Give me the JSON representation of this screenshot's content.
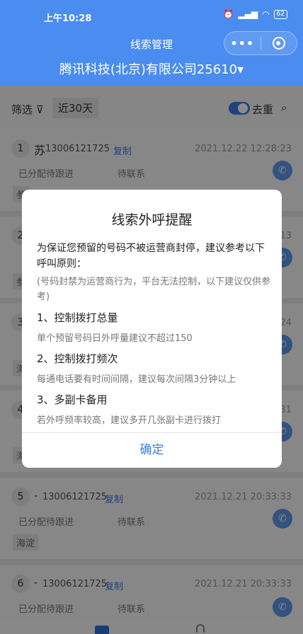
{
  "status": {
    "time": "上午10:28",
    "battery": "62"
  },
  "nav": {
    "title": "线索管理",
    "more": "•••"
  },
  "company": "腾讯科技(北京)有限公司25610▾",
  "filter": {
    "label": "筛选 ⊽",
    "range": "近30天",
    "dedup": "去重"
  },
  "cards": [
    {
      "num": "1",
      "name": "苏",
      "phone": "13006121725",
      "copy": "复制",
      "time": "2021.12.22 12:28:23",
      "status1": "已分配待跟进",
      "status2": "待联系",
      "tag": "参"
    },
    {
      "num": "2",
      "name": "",
      "phone": "",
      "copy": "",
      "time": "13",
      "status1": "",
      "status2": "",
      "tag": "参"
    },
    {
      "num": "3",
      "name": "",
      "phone": "",
      "copy": "",
      "time": "24",
      "status1": "",
      "status2": "",
      "tag": "海"
    },
    {
      "num": "4",
      "name": "",
      "phone": "",
      "copy": "",
      "time": "31",
      "status1": "",
      "status2": "",
      "tag": "海"
    },
    {
      "num": "5",
      "name": "-",
      "phone": "13006121725",
      "copy": "复制",
      "time": "2021.12.21 20:33:33",
      "status1": "已分配待跟进",
      "status2": "待联系",
      "tag": "海淀"
    },
    {
      "num": "6",
      "name": "-",
      "phone": "13006121725",
      "copy": "复制",
      "time": "2021.12.21 20:33:33",
      "status1": "已分配待跟进",
      "status2": "待联系",
      "tag": ""
    }
  ],
  "modal": {
    "title": "线索外呼提醒",
    "intro": "为保证您预留的号码不被运营商封停，建议参考以下呼叫原则：",
    "note": "(号码封禁为运营商行为，平台无法控制，以下建议仅供参考)",
    "rules": [
      {
        "title": "1、控制拨打总量",
        "desc": "单个预留号码日外呼量建议不超过150"
      },
      {
        "title": "2、控制拨打频次",
        "desc": "每通电话要有时间间隔，建议每次间隔3分钟以上"
      },
      {
        "title": "3、多副卡备用",
        "desc": "若外呼频率较高，建议多开几张副卡进行拨打"
      }
    ],
    "confirm": "确定"
  }
}
